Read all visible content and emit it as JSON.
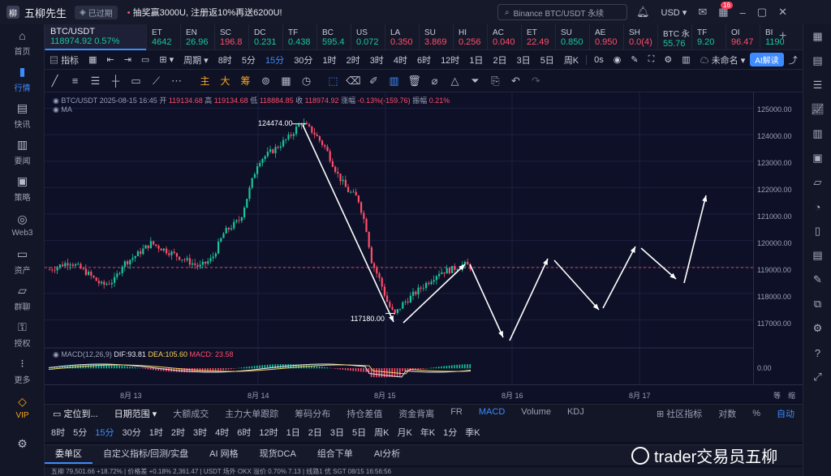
{
  "titlebar": {
    "app_name": "五柳先生",
    "expired_label": "已过期",
    "promo_text": "抽奖赢3000U, 注册返10%再送6200U!",
    "search_placeholder": "Binance BTC/USDT 永续",
    "currency": "USD",
    "notif_badge": "16"
  },
  "left_nav": [
    {
      "label": "首页",
      "icon": "home-icon"
    },
    {
      "label": "行情",
      "icon": "chart-bars-icon"
    },
    {
      "label": "快讯",
      "icon": "news-icon"
    },
    {
      "label": "要闻",
      "icon": "doc-icon"
    },
    {
      "label": "策略",
      "icon": "strategy-icon"
    },
    {
      "label": "Web3",
      "icon": "web3-icon"
    },
    {
      "label": "资产",
      "icon": "wallet-icon"
    },
    {
      "label": "群聊",
      "icon": "chat-icon"
    },
    {
      "label": "授权",
      "icon": "key-icon"
    },
    {
      "label": "更多",
      "icon": "more-icon"
    },
    {
      "label": "VIP",
      "icon": "vip-icon"
    }
  ],
  "tickers": {
    "main": {
      "name": "BTC/USDT",
      "price": "118974.92",
      "change": "0.57%"
    },
    "others": [
      {
        "name": "ET",
        "price": "4642",
        "dir": "up"
      },
      {
        "name": "EN",
        "price": "26.96",
        "dir": "up"
      },
      {
        "name": "SC",
        "price": "196.8",
        "dir": "down"
      },
      {
        "name": "DC",
        "price": "0.231",
        "dir": "up"
      },
      {
        "name": "TF",
        "price": "0.438",
        "dir": "up"
      },
      {
        "name": "BC",
        "price": "595.4",
        "dir": "up"
      },
      {
        "name": "US",
        "price": "0.072",
        "dir": "up"
      },
      {
        "name": "LA",
        "price": "0.350",
        "dir": "down"
      },
      {
        "name": "SU",
        "price": "3.869",
        "dir": "down"
      },
      {
        "name": "HI",
        "price": "0.256",
        "dir": "down"
      },
      {
        "name": "AC",
        "price": "0.040",
        "dir": "down"
      },
      {
        "name": "ET",
        "price": "22.49",
        "dir": "down"
      },
      {
        "name": "SU",
        "price": "0.850",
        "dir": "up"
      },
      {
        "name": "AE",
        "price": "0.950",
        "dir": "down"
      },
      {
        "name": "SH",
        "price": "0.0(4)",
        "dir": "down"
      },
      {
        "name": "BTC 永",
        "price": "55.76",
        "dir": "up"
      },
      {
        "name": "TF",
        "price": "9.20",
        "dir": "up"
      },
      {
        "name": "OI",
        "price": "96.47",
        "dir": "down"
      },
      {
        "name": "BI",
        "price": "1190",
        "dir": "up"
      }
    ]
  },
  "toolbar1": {
    "indicator": "指标",
    "period": "周期",
    "intervals": [
      "8时",
      "5分",
      "15分",
      "30分",
      "1时",
      "2时",
      "3时",
      "4时",
      "6时",
      "12时",
      "1日",
      "2日",
      "3日",
      "5日",
      "周K"
    ],
    "selected_interval": "15分",
    "countdown": "0s",
    "unnamed": "未命名",
    "ai_button": "AI解读"
  },
  "toolbar2": {
    "main_label": "主",
    "big_label": "大",
    "chip_label": "筹"
  },
  "chart_info": {
    "symbol": "BTC/USDT",
    "datetime": "2025-08-15 16:45",
    "open_label": "开",
    "open": "119134.68",
    "high_label": "高",
    "high": "119134.68",
    "low_label": "低",
    "low": "118884.85",
    "close_label": "收",
    "close": "118974.92",
    "change_label": "涨幅",
    "change": "-0.13%(-159.76)",
    "amp_label": "振幅",
    "amp": "0.21%",
    "ma_label": "MA",
    "macd_label": "MACD(12,26,9)",
    "dif": "DIF:93.81",
    "dea": "DEA:105.60",
    "macd": "MACD: 23.58",
    "high_annotation": "124474.00",
    "low_annotation": "117180.00"
  },
  "price_axis": [
    "125000.00",
    "124000.00",
    "123000.00",
    "122000.00",
    "121000.00",
    "120000.00",
    "119000.00",
    "118000.00",
    "117000.00",
    "0.00"
  ],
  "time_axis": [
    "8月 13",
    "8月 14",
    "8月 15",
    "8月 16",
    "8月 17"
  ],
  "time_axis_right": [
    "等",
    "缩"
  ],
  "chart_data": {
    "type": "candlestick",
    "y_range": [
      116400,
      125600
    ],
    "candles_summary": "price path from 119000 up to 124474 then down to 117180 then up to ~119000",
    "key_points": [
      {
        "label": "124474.00",
        "value": 124474
      },
      {
        "label": "117180.00",
        "value": 117180
      }
    ],
    "current_price": 118974.92
  },
  "bottom_tabs1": {
    "locate": "定位到...",
    "date_range": "日期范围",
    "tabs": [
      "大额成交",
      "主力大单跟踪",
      "筹码分布",
      "持仓差值",
      "资金背离",
      "FR",
      "MACD",
      "Volume",
      "KDJ"
    ],
    "active": "MACD",
    "community": "社区指标",
    "log": "对数",
    "pct": "%",
    "auto": "自动"
  },
  "bottom_tabs2": {
    "items": [
      "8时",
      "5分",
      "15分",
      "30分",
      "1时",
      "2时",
      "3时",
      "4时",
      "6时",
      "12时",
      "1日",
      "2日",
      "3日",
      "5日",
      "周K",
      "月K",
      "年K",
      "1分",
      "季K"
    ],
    "selected": "15分"
  },
  "bottom_tabs3": {
    "items": [
      "委单区",
      "自定义指标/回测/实盘",
      "AI 网格",
      "现货DCA",
      "组合下单",
      "AI分析"
    ],
    "selected": "委单区"
  },
  "status_strip": "五柳  79,501.66  +18.72%  | 价格差  +0.18%  2,361.47  | USDT 场外 OKX 溢价 0.70% 7.13  | 线路1 优  SGT 08/15 16:56:56",
  "watermark": "trader交易员五柳"
}
